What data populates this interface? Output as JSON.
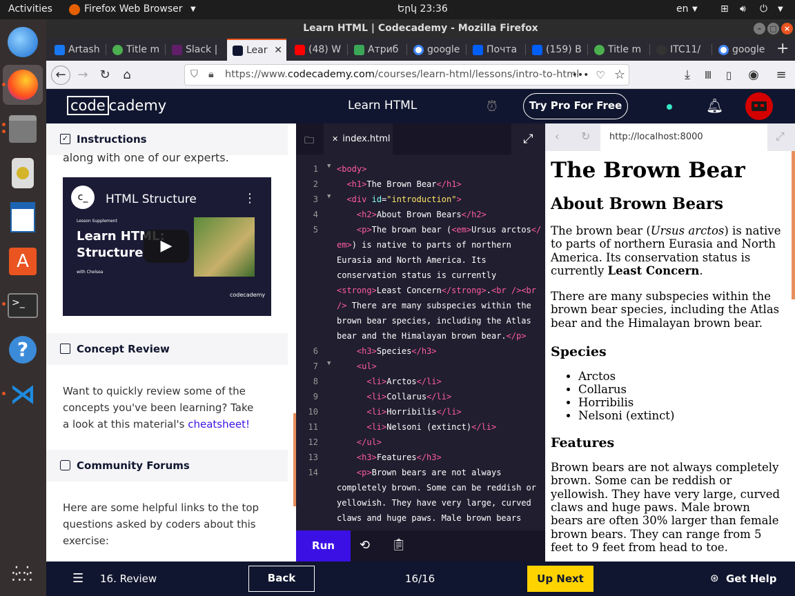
{
  "topbar": {
    "activities": "Activities",
    "app": "Firefox Web Browser",
    "clock": "Երկ 23:36",
    "lang": "en"
  },
  "window": {
    "title": "Learn HTML | Codecademy - Mozilla Firefox"
  },
  "tabs": [
    {
      "label": "Artash",
      "color": "#1877f2"
    },
    {
      "label": "Title m",
      "color": "#4caf50"
    },
    {
      "label": "Slack |",
      "color": "#611f69"
    },
    {
      "label": "Lear",
      "color": "#10162f"
    },
    {
      "label": "(48) W",
      "color": "#ff0000"
    },
    {
      "label": "Атриб",
      "color": "#3aa757"
    },
    {
      "label": "google",
      "color": "#4285f4"
    },
    {
      "label": "Почта",
      "color": "#005ff9"
    },
    {
      "label": "(159) B",
      "color": "#005ff9"
    },
    {
      "label": "Title m",
      "color": "#4caf50"
    },
    {
      "label": "ITC11/",
      "color": "#333333"
    },
    {
      "label": "google",
      "color": "#4285f4"
    }
  ],
  "navbar": {
    "url_prefix": "https://www.",
    "url_domain": "codecademy.com",
    "url_path": "/courses/learn-html/lessons/intro-to-html"
  },
  "header": {
    "logo_left": "code",
    "logo_right": "cademy",
    "course": "Learn HTML",
    "try_pro": "Try Pro For Free"
  },
  "left": {
    "instructions": "Instructions",
    "partial_text": "along with one of our experts.",
    "video": {
      "title": "HTML Structure",
      "supplement": "Lesson Supplement",
      "heading": "Learn HTML: Structure",
      "with": "with Chelsea",
      "brand": "codecademy"
    },
    "concept_review": "Concept Review",
    "concept_text_1": "Want to quickly review some of the concepts you've been learning? Take a look at this material's ",
    "cheatsheet": "cheatsheet!",
    "community": "Community Forums",
    "community_text": "Here are some helpful links to the top questions asked by coders about this exercise:"
  },
  "editor": {
    "filename": "index.html",
    "run": "Run"
  },
  "preview": {
    "url": "http://localhost:8000",
    "h1": "The Brown Bear",
    "h2": "About Brown Bears",
    "p1_a": "The brown bear (",
    "p1_em": "Ursus arctos",
    "p1_b": ") is native to parts of northern Eurasia and North America. Its conservation status is currently ",
    "p1_strong": "Least Concern",
    "p1_c": ".",
    "p2": "There are many subspecies within the brown bear species, including the Atlas bear and the Himalayan brown bear.",
    "h3_species": "Species",
    "species": [
      "Arctos",
      "Collarus",
      "Horribilis",
      "Nelsoni (extinct)"
    ],
    "h3_features": "Features",
    "p3": "Brown bears are not always completely brown. Some can be reddish or yellowish. They have very large, curved claws and huge paws. Male brown bears are often 30% larger than female brown bears. They can range from 5 feet to 9 feet from head to toe."
  },
  "bottom": {
    "lesson": "16. Review",
    "back": "Back",
    "progress": "16/16",
    "next": "Up Next",
    "help": "Get Help"
  }
}
